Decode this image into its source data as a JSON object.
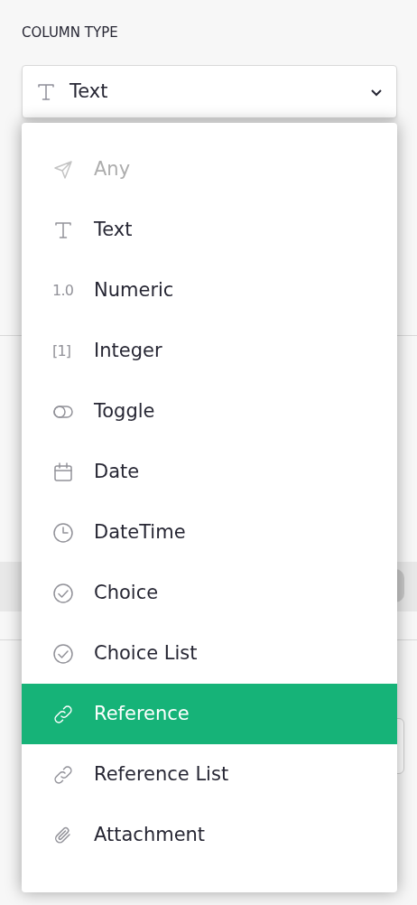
{
  "section_label": "COLUMN TYPE",
  "select": {
    "value": "Text",
    "kind": "text",
    "expanded": true
  },
  "menu": {
    "items": [
      {
        "label": "Any",
        "kind": "send",
        "disabled": true,
        "selected": false
      },
      {
        "label": "Text",
        "kind": "text",
        "disabled": false,
        "selected": false
      },
      {
        "label": "Numeric",
        "glyph": "1.0",
        "disabled": false,
        "selected": false
      },
      {
        "label": "Integer",
        "glyph": "[1]",
        "disabled": false,
        "selected": false
      },
      {
        "label": "Toggle",
        "kind": "toggle",
        "disabled": false,
        "selected": false
      },
      {
        "label": "Date",
        "kind": "calendar",
        "disabled": false,
        "selected": false
      },
      {
        "label": "DateTime",
        "kind": "clock",
        "disabled": false,
        "selected": false
      },
      {
        "label": "Choice",
        "kind": "choice",
        "disabled": false,
        "selected": false
      },
      {
        "label": "Choice List",
        "kind": "choice",
        "disabled": false,
        "selected": false
      },
      {
        "label": "Reference",
        "kind": "link",
        "disabled": false,
        "selected": true
      },
      {
        "label": "Reference List",
        "kind": "link",
        "disabled": false,
        "selected": false
      },
      {
        "label": "Attachment",
        "kind": "paperclip",
        "disabled": false,
        "selected": false
      }
    ]
  }
}
